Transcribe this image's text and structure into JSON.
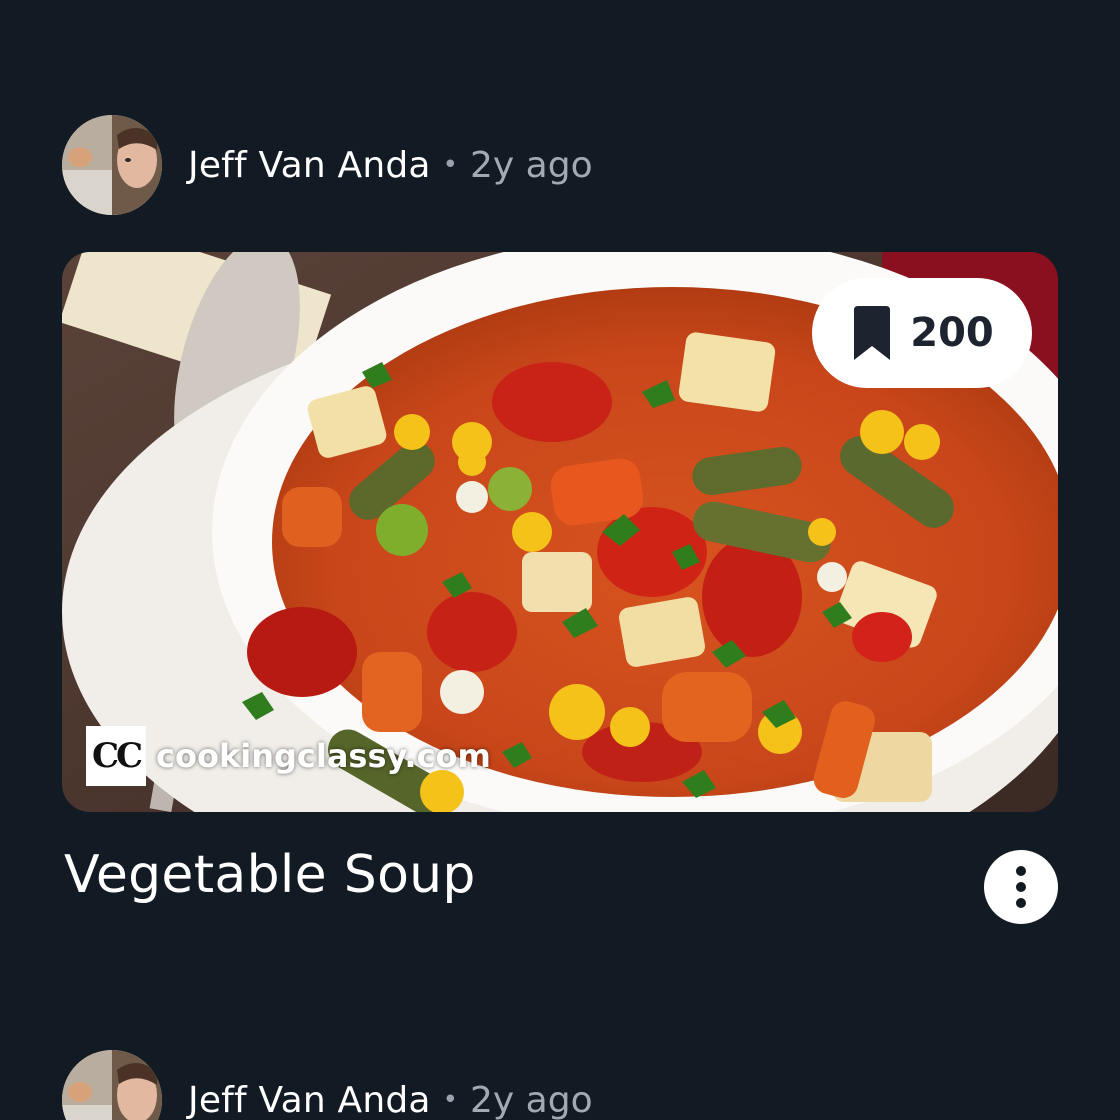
{
  "posts": [
    {
      "author": "Jeff Van Anda",
      "separator": "•",
      "time": "2y ago",
      "save_count": "200",
      "watermark": {
        "logo": "CC",
        "text": "cookingclassy.com"
      },
      "title": "Vegetable Soup",
      "icons": {
        "save": "bookmark-icon",
        "more": "more-vertical-icon"
      }
    },
    {
      "author": "Jeff Van Anda",
      "separator": "•",
      "time": "2y ago"
    }
  ],
  "colors": {
    "background": "#121a23",
    "text_primary": "#ffffff",
    "text_secondary": "#a2a9b2",
    "pill_background": "#ffffff",
    "pill_text": "#1d2430"
  }
}
